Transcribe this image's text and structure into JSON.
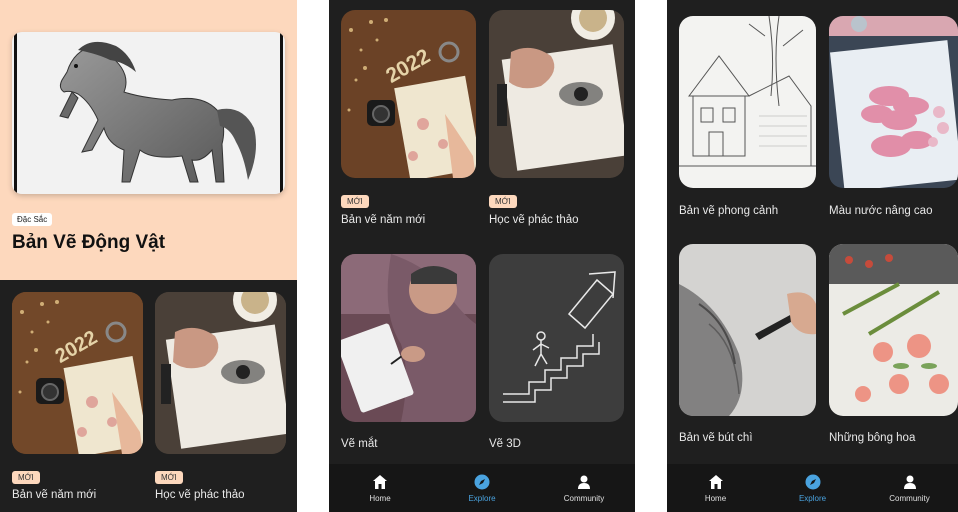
{
  "screen1": {
    "featured_badge": "Đặc Sắc",
    "featured_title": "Bản Vẽ Động Vật",
    "cards": [
      {
        "badge": "MỚI",
        "label": "Bản vẽ năm mới"
      },
      {
        "badge": "MỚI",
        "label": "Học vẽ phác thảo"
      }
    ]
  },
  "screen2": {
    "cards": [
      {
        "badge": "MỚI",
        "label": "Bản vẽ năm mới",
        "year": "2022"
      },
      {
        "badge": "MỚI",
        "label": "Học vẽ phác thảo"
      },
      {
        "label": "Vẽ mắt"
      },
      {
        "label": "Vẽ 3D"
      }
    ],
    "nav": [
      {
        "label": "Home",
        "icon": "home-icon"
      },
      {
        "label": "Explore",
        "icon": "compass-icon",
        "active": true
      },
      {
        "label": "Community",
        "icon": "person-icon"
      }
    ]
  },
  "screen3": {
    "cards": [
      {
        "label": "Bản vẽ phong cảnh"
      },
      {
        "label": "Màu nước nâng cao"
      },
      {
        "label": "Bản vẽ bút chì"
      },
      {
        "label": "Những bông hoa"
      }
    ],
    "nav": [
      {
        "label": "Home",
        "icon": "home-icon"
      },
      {
        "label": "Explore",
        "icon": "compass-icon",
        "active": true
      },
      {
        "label": "Community",
        "icon": "person-icon"
      }
    ]
  },
  "colors": {
    "accent": "#4aa3df",
    "badge_bg": "#fdd8bd",
    "background": "#1f1f1f"
  }
}
